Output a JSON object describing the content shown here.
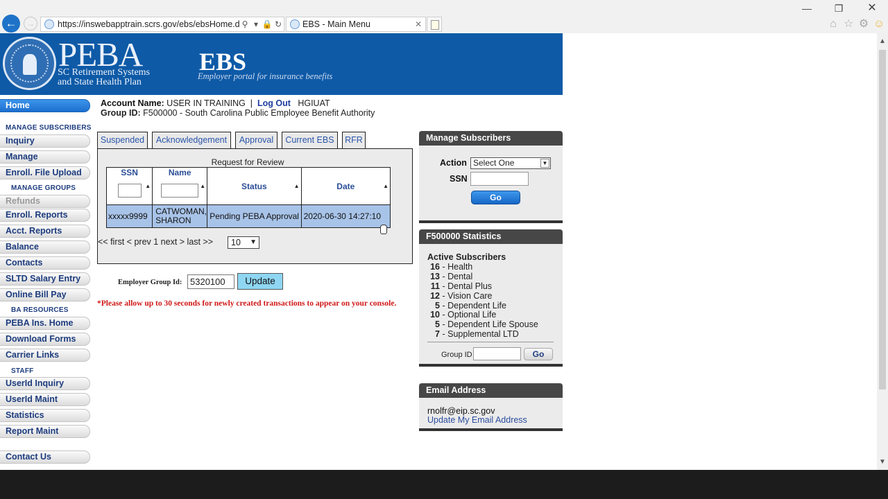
{
  "browser": {
    "url": "https://inswebapptrain.scrs.gov/ebs/ebsHome.dc",
    "tab_title": "EBS - Main Menu",
    "tab_close": "✕"
  },
  "header": {
    "logo_text": "PEBA",
    "logo_line1": "SC Retirement Systems",
    "logo_line2": "and State Health Plan",
    "app_title": "EBS",
    "app_subtitle": "Employer portal for insurance benefits"
  },
  "sidebar": {
    "home": "Home",
    "sections": {
      "manage_subscribers": "MANAGE SUBSCRIBERS",
      "manage_groups": "MANAGE GROUPS",
      "ba_resources": "BA RESOURCES",
      "staff": "STAFF"
    },
    "items": {
      "inquiry": "Inquiry",
      "manage": "Manage",
      "enroll_file_upload": "Enroll. File Upload",
      "refunds": "Refunds",
      "enroll_reports": "Enroll. Reports",
      "acct_reports": "Acct. Reports",
      "balance": "Balance",
      "contacts": "Contacts",
      "sltd_salary_entry": "SLTD Salary Entry",
      "online_bill_pay": "Online Bill Pay",
      "peba_ins_home": "PEBA Ins. Home",
      "download_forms": "Download Forms",
      "carrier_links": "Carrier Links",
      "userid_inquiry": "UserId Inquiry",
      "userid_maint": "UserId Maint",
      "statistics": "Statistics",
      "report_maint": "Report Maint",
      "contact_us": "Contact Us"
    }
  },
  "account": {
    "name_label": "Account Name:",
    "name_value": "USER IN TRAINING",
    "separator": "|",
    "logout": "Log Out",
    "env": "HGIUAT",
    "group_label": "Group ID:",
    "group_value": "F500000 - South Carolina Public Employee Benefit Authority"
  },
  "tabs": {
    "suspended": "Suspended",
    "acknowledgement": "Acknowledgement",
    "approval": "Approval",
    "current_ebs": "Current EBS",
    "rfr": "RFR"
  },
  "rfr": {
    "caption": "Request for Review",
    "columns": {
      "ssn": "SSN",
      "name": "Name",
      "status": "Status",
      "date": "Date"
    },
    "rows": [
      {
        "ssn": "xxxxx9999",
        "name": "CATWOMAN, SHARON",
        "status": "Pending PEBA Approval",
        "date": "2020-06-30 14:27:10"
      }
    ],
    "pager": "<< first < prev 1 next > last >>",
    "page_size": "10"
  },
  "employer_group": {
    "label": "Employer Group Id:",
    "value": "5320100",
    "update": "Update"
  },
  "notice": "*Please allow up to 30 seconds for newly created transactions to appear on your console.",
  "manage_subscribers": {
    "title": "Manage Subscribers",
    "action_label": "Action",
    "action_value": "Select One",
    "ssn_label": "SSN",
    "go": "Go"
  },
  "stats": {
    "title": "F500000 Statistics",
    "subtitle": "Active Subscribers",
    "rows": [
      {
        "count": "16",
        "label": "- Health"
      },
      {
        "count": "13",
        "label": "- Dental"
      },
      {
        "count": "11",
        "label": "- Dental Plus"
      },
      {
        "count": "12",
        "label": "- Vision Care"
      },
      {
        "count": "5",
        "label": "- Dependent Life"
      },
      {
        "count": "10",
        "label": "- Optional Life"
      },
      {
        "count": "5",
        "label": "- Dependent Life Spouse"
      },
      {
        "count": "7",
        "label": "- Supplemental LTD"
      }
    ],
    "group_id_label": "Group ID",
    "go": "Go"
  },
  "email": {
    "title": "Email Address",
    "address": "rnolfr@eip.sc.gov",
    "update_link": "Update My Email Address"
  },
  "colors": {
    "banner": "#0e5aa7",
    "active_nav": "#1d6fcf",
    "row_highlight": "#a8c3e8",
    "notice_red": "#d01818"
  }
}
